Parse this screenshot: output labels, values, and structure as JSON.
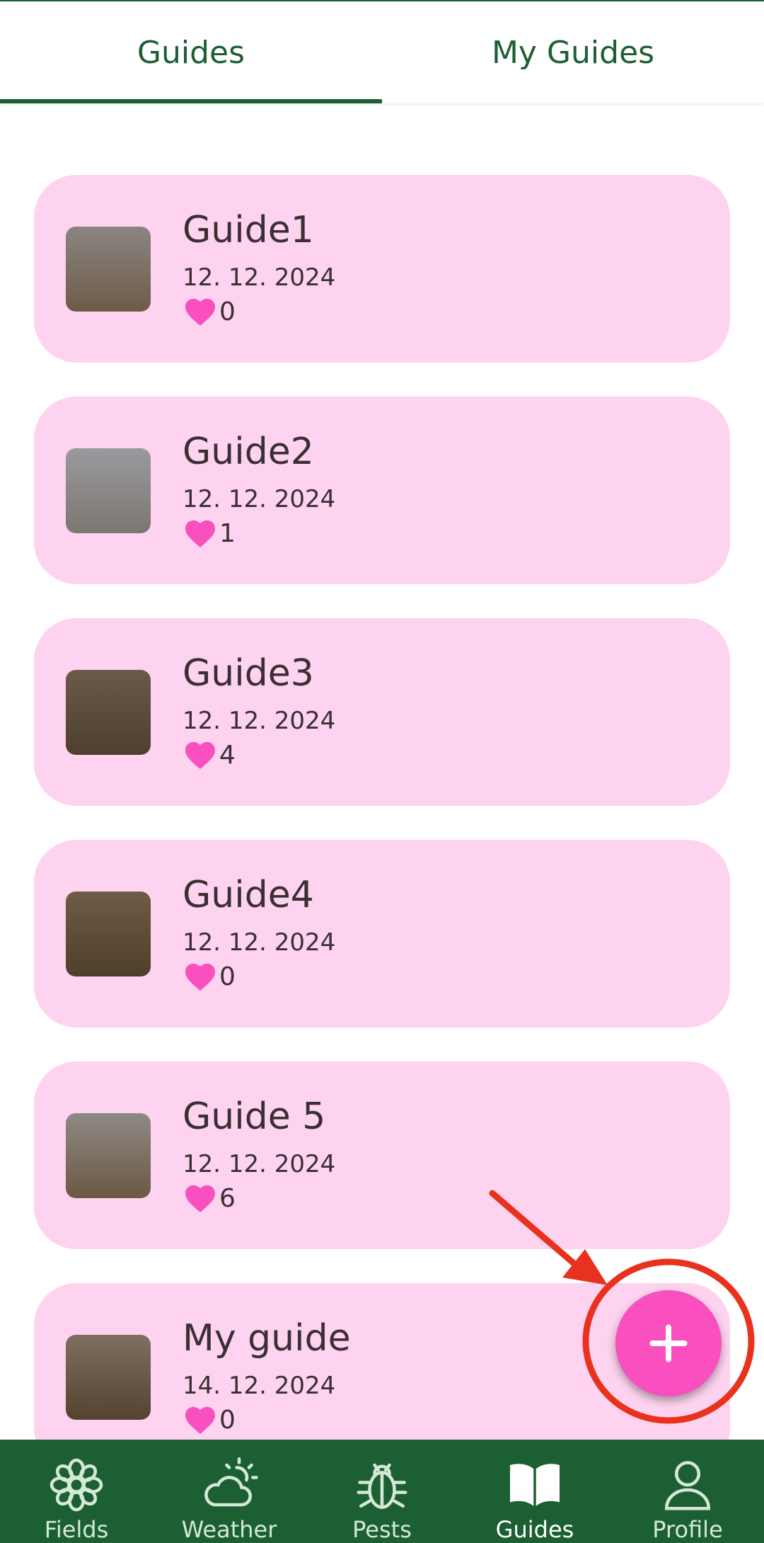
{
  "tabs": {
    "items": [
      {
        "label": "Guides",
        "active": true
      },
      {
        "label": "My Guides",
        "active": false
      }
    ]
  },
  "guides": [
    {
      "title": "Guide1",
      "date": "12. 12. 2024",
      "likes": "0",
      "thumb_colors": [
        "#8a8583",
        "#6e5b45"
      ]
    },
    {
      "title": "Guide2",
      "date": "12. 12. 2024",
      "likes": "1",
      "thumb_colors": [
        "#9a9a9e",
        "#7c7670"
      ]
    },
    {
      "title": "Guide3",
      "date": "12. 12. 2024",
      "likes": "4",
      "thumb_colors": [
        "#6a5a48",
        "#4e3f2e"
      ]
    },
    {
      "title": "Guide4",
      "date": "12. 12. 2024",
      "likes": "0",
      "thumb_colors": [
        "#6e5c46",
        "#4f3e2b"
      ]
    },
    {
      "title": "Guide 5",
      "date": "12. 12. 2024",
      "likes": "6",
      "thumb_colors": [
        "#8e8984",
        "#6c5843"
      ]
    },
    {
      "title": "My guide",
      "date": "14. 12. 2024",
      "likes": "0",
      "thumb_colors": [
        "#7e6f60",
        "#54432f"
      ]
    }
  ],
  "fab": {
    "icon": "plus-icon",
    "color": "#f94fbf"
  },
  "annotation": {
    "color": "#e8321e"
  },
  "bottom_nav": {
    "items": [
      {
        "label": "Fields",
        "icon": "flower-icon",
        "active": false
      },
      {
        "label": "Weather",
        "icon": "partly-cloudy-icon",
        "active": false
      },
      {
        "label": "Pests",
        "icon": "bug-icon",
        "active": false
      },
      {
        "label": "Guides",
        "icon": "book-icon",
        "active": true
      },
      {
        "label": "Profile",
        "icon": "person-icon",
        "active": false
      }
    ]
  },
  "colors": {
    "primary": "#1c5f33",
    "card": "#fdd3ef",
    "heart": "#f94fbf"
  }
}
